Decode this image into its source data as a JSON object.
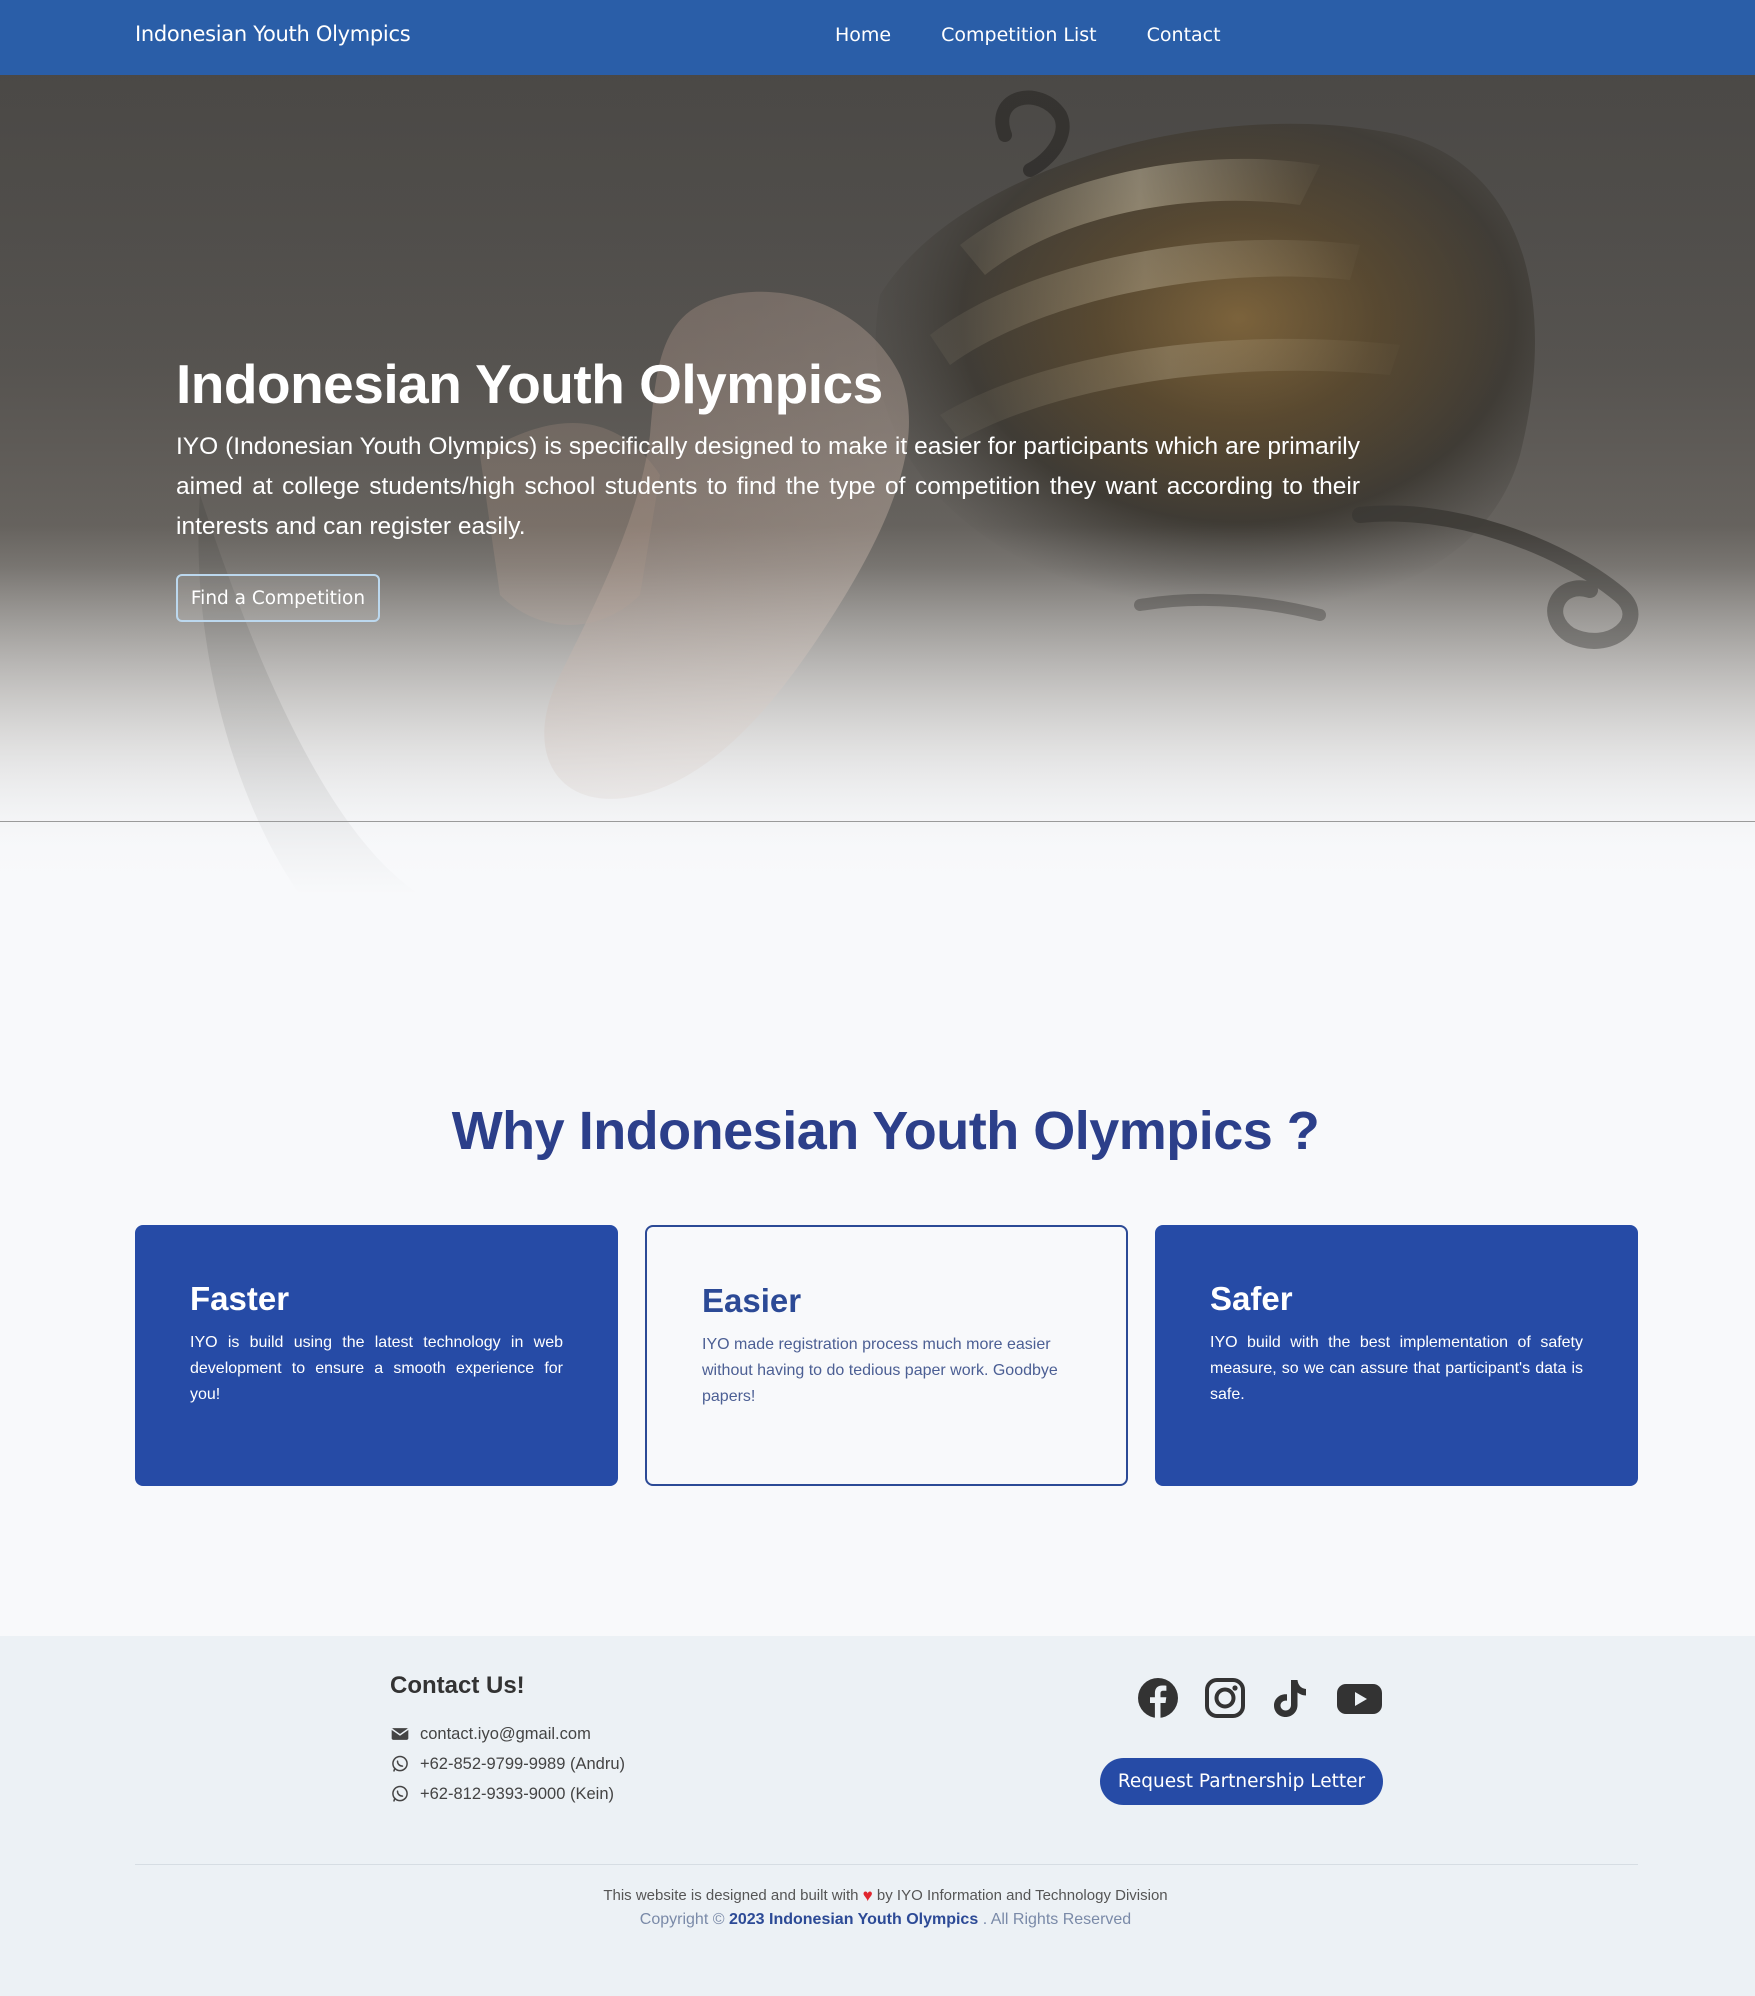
{
  "navbar": {
    "brand": "Indonesian Youth Olympics",
    "links": [
      "Home",
      "Competition List",
      "Contact"
    ]
  },
  "hero": {
    "title": "Indonesian Youth Olympics",
    "description": "IYO (Indonesian Youth Olympics) is specifically designed to make it easier for participants which are primarily aimed at college students/high school students to find the type of competition they want according to their interests and can register easily.",
    "button_label": "Find a Competition"
  },
  "why": {
    "title": "Why Indonesian Youth Olympics ?",
    "cards": [
      {
        "title": "Faster",
        "text": "IYO is build using the latest technology in web development to ensure a smooth experience for you!"
      },
      {
        "title": "Easier",
        "text": "IYO made registration process much more easier without having to do tedious paper work. Goodbye papers!"
      },
      {
        "title": "Safer",
        "text": "IYO build with the best implementation of safety measure, so we can assure that participant's data is safe."
      }
    ]
  },
  "footer": {
    "contact_title": "Contact Us!",
    "email": "contact.iyo@gmail.com",
    "phones": [
      "+62-852-9799-9989 (Andru)",
      "+62-812-9393-9000 (Kein)"
    ],
    "social_icons": [
      "facebook-icon",
      "instagram-icon",
      "tiktok-icon",
      "youtube-icon"
    ],
    "partner_button": "Request Partnership Letter",
    "credit_before": "This website is designed and built with",
    "credit_after": "by IYO Information and Technology Division",
    "copyright_prefix": "Copyright ©",
    "copyright_name": "2023 Indonesian Youth Olympics",
    "copyright_suffix": ". All Rights Reserved"
  },
  "colors": {
    "navbar": "#2a5ea8",
    "primary": "#264ba6",
    "heading": "#2c3f8a",
    "footer_bg": "#ecf1f5",
    "heart": "#e0262f"
  }
}
